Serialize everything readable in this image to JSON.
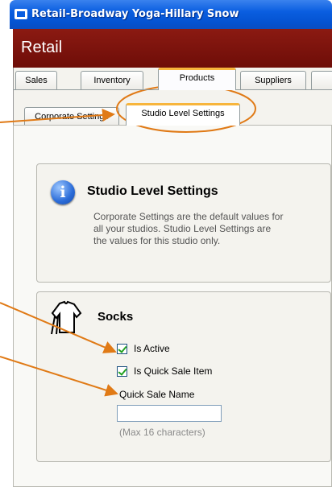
{
  "window": {
    "title": "Retail-Broadway Yoga-Hillary Snow"
  },
  "app": {
    "header": "Retail"
  },
  "tabs": [
    {
      "label": "Sales"
    },
    {
      "label": "Inventory"
    },
    {
      "label": "Products",
      "active": true
    },
    {
      "label": "Suppliers"
    }
  ],
  "subtabs": [
    {
      "label": "Corporate Settings"
    },
    {
      "label": "Studio Level Settings",
      "active": true
    }
  ],
  "info": {
    "title": "Studio Level Settings",
    "lines": [
      "Corporate Settings are the default values for",
      "all your studios. Studio Level Settings are",
      "the values for this studio only."
    ]
  },
  "product": {
    "name": "Socks",
    "is_active_label": "Is Active",
    "is_active_checked": true,
    "quick_sale_label": "Is Quick Sale Item",
    "quick_sale_checked": true,
    "quick_sale_name_label": "Quick Sale Name",
    "quick_sale_name_value": "",
    "hint": "(Max 16 characters)"
  },
  "colors": {
    "annotation": "#e07a16",
    "app_header": "#7a120c",
    "titlebar": "#0a5ee0"
  }
}
